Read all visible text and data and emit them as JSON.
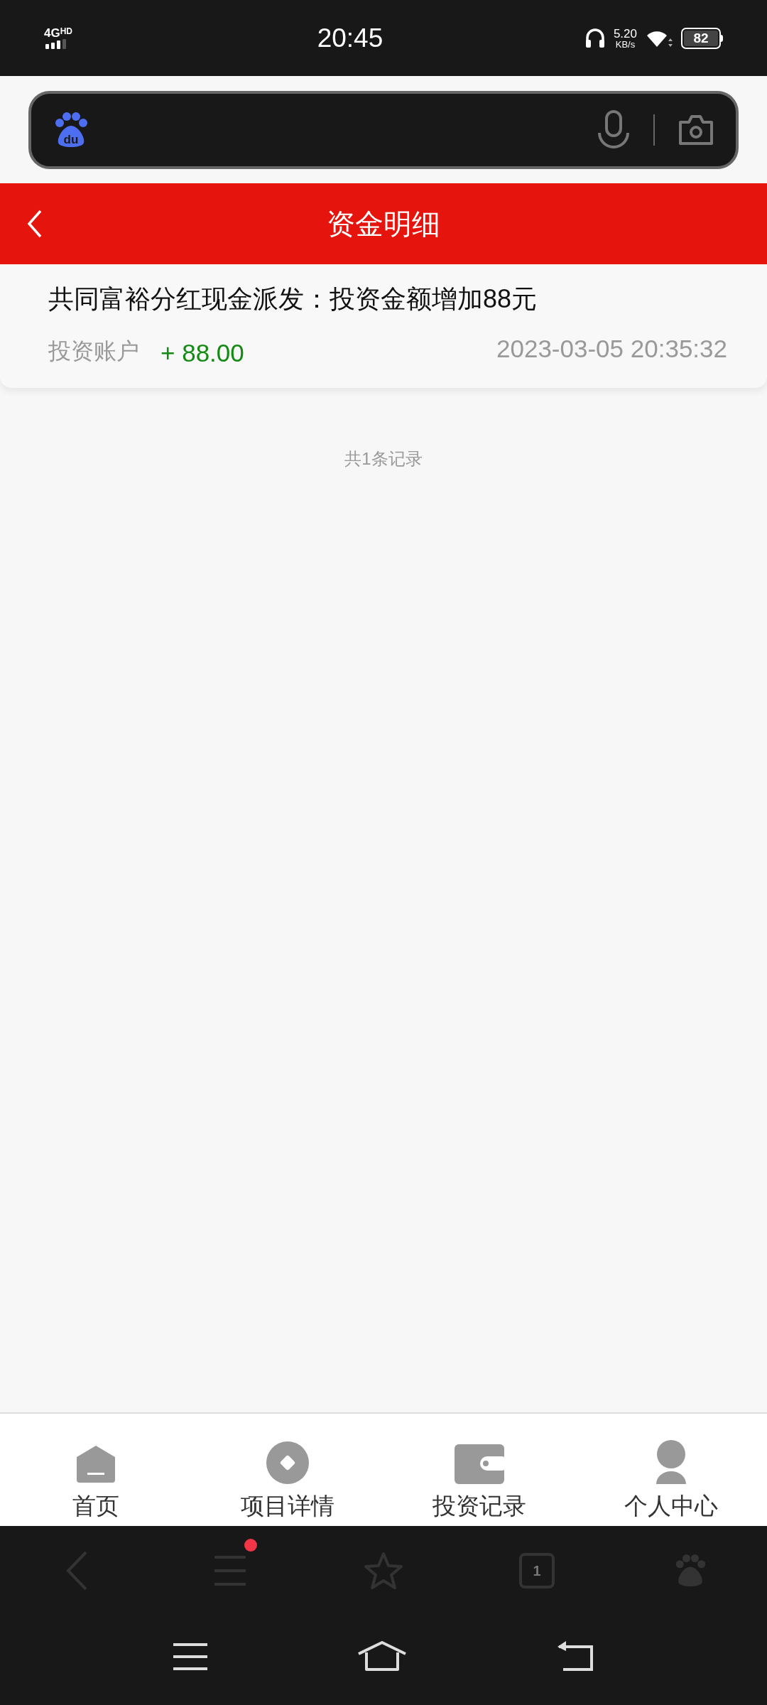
{
  "status_bar": {
    "network": "4G",
    "network_badge": "HD",
    "time": "20:45",
    "speed": "5.20",
    "speed_unit": "KB/s",
    "battery": "82"
  },
  "browser": {
    "logo_text": "du"
  },
  "header": {
    "title": "资金明细"
  },
  "records": [
    {
      "title": "共同富裕分红现金派发：投资金额增加88元",
      "account": "投资账户",
      "amount": "+ 88.00",
      "time": "2023-03-05 20:35:32"
    }
  ],
  "summary": "共1条记录",
  "tab_bar": [
    {
      "label": "首页",
      "kind": "home"
    },
    {
      "label": "项目详情",
      "kind": "disc"
    },
    {
      "label": "投资记录",
      "kind": "wallet"
    },
    {
      "label": "个人中心",
      "kind": "person"
    }
  ],
  "browser_toolbar": {
    "tab_count": "1",
    "menu_badge": true
  }
}
